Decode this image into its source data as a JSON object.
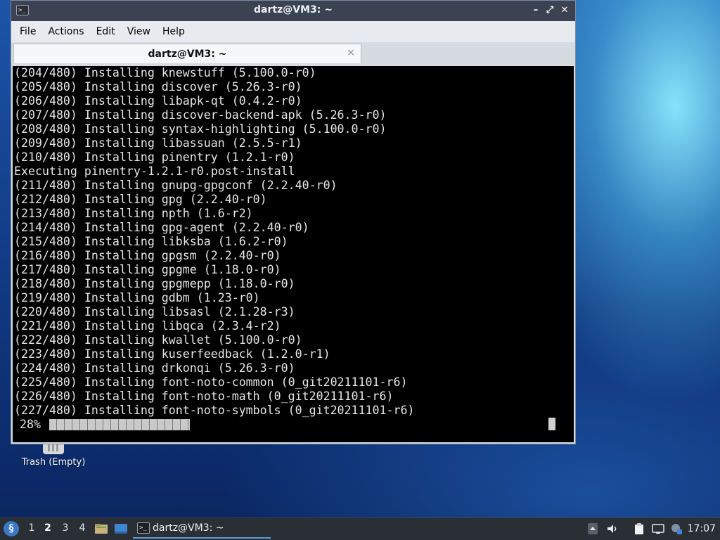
{
  "desktop": {
    "trash_label": "Trash (Empty)"
  },
  "window": {
    "title": "dartz@VM3: ~",
    "controls": {
      "minimize": "–",
      "maximize": "⤢",
      "close": "✕"
    },
    "menu": [
      "File",
      "Actions",
      "Edit",
      "View",
      "Help"
    ],
    "tab": {
      "label": "dartz@VM3: ~",
      "close": "×"
    }
  },
  "terminal": {
    "lines": [
      "(204/480) Installing knewstuff (5.100.0-r0)",
      "(205/480) Installing discover (5.26.3-r0)",
      "(206/480) Installing libapk-qt (0.4.2-r0)",
      "(207/480) Installing discover-backend-apk (5.26.3-r0)",
      "(208/480) Installing syntax-highlighting (5.100.0-r0)",
      "(209/480) Installing libassuan (2.5.5-r1)",
      "(210/480) Installing pinentry (1.2.1-r0)",
      "Executing pinentry-1.2.1-r0.post-install",
      "(211/480) Installing gnupg-gpgconf (2.2.40-r0)",
      "(212/480) Installing gpg (2.2.40-r0)",
      "(213/480) Installing npth (1.6-r2)",
      "(214/480) Installing gpg-agent (2.2.40-r0)",
      "(215/480) Installing libksba (1.6.2-r0)",
      "(216/480) Installing gpgsm (2.2.40-r0)",
      "(217/480) Installing gpgme (1.18.0-r0)",
      "(218/480) Installing gpgmepp (1.18.0-r0)",
      "(219/480) Installing gdbm (1.23-r0)",
      "(220/480) Installing libsasl (2.1.28-r3)",
      "(221/480) Installing libqca (2.3.4-r2)",
      "(222/480) Installing kwallet (5.100.0-r0)",
      "(223/480) Installing kuserfeedback (1.2.0-r1)",
      "(224/480) Installing drkonqi (5.26.3-r0)",
      "(225/480) Installing font-noto-common (0_git20211101-r6)",
      "(226/480) Installing font-noto-math (0_git20211101-r6)",
      "(227/480) Installing font-noto-symbols (0_git20211101-r6)"
    ],
    "progress_text": "28%",
    "progress_value": 0.28
  },
  "taskbar": {
    "start_icon": "lxqt-start-icon",
    "workspaces": [
      "1",
      "2",
      "3",
      "4"
    ],
    "active_workspace": "2",
    "task_label": "dartz@VM3: ~",
    "clock": "17:07"
  },
  "colors": {
    "terminal_bg": "#000000",
    "terminal_fg": "#e6e6e6",
    "titlebar": "#3b4252",
    "taskbar": "#2a2e35",
    "accent": "#5b9bd5"
  }
}
